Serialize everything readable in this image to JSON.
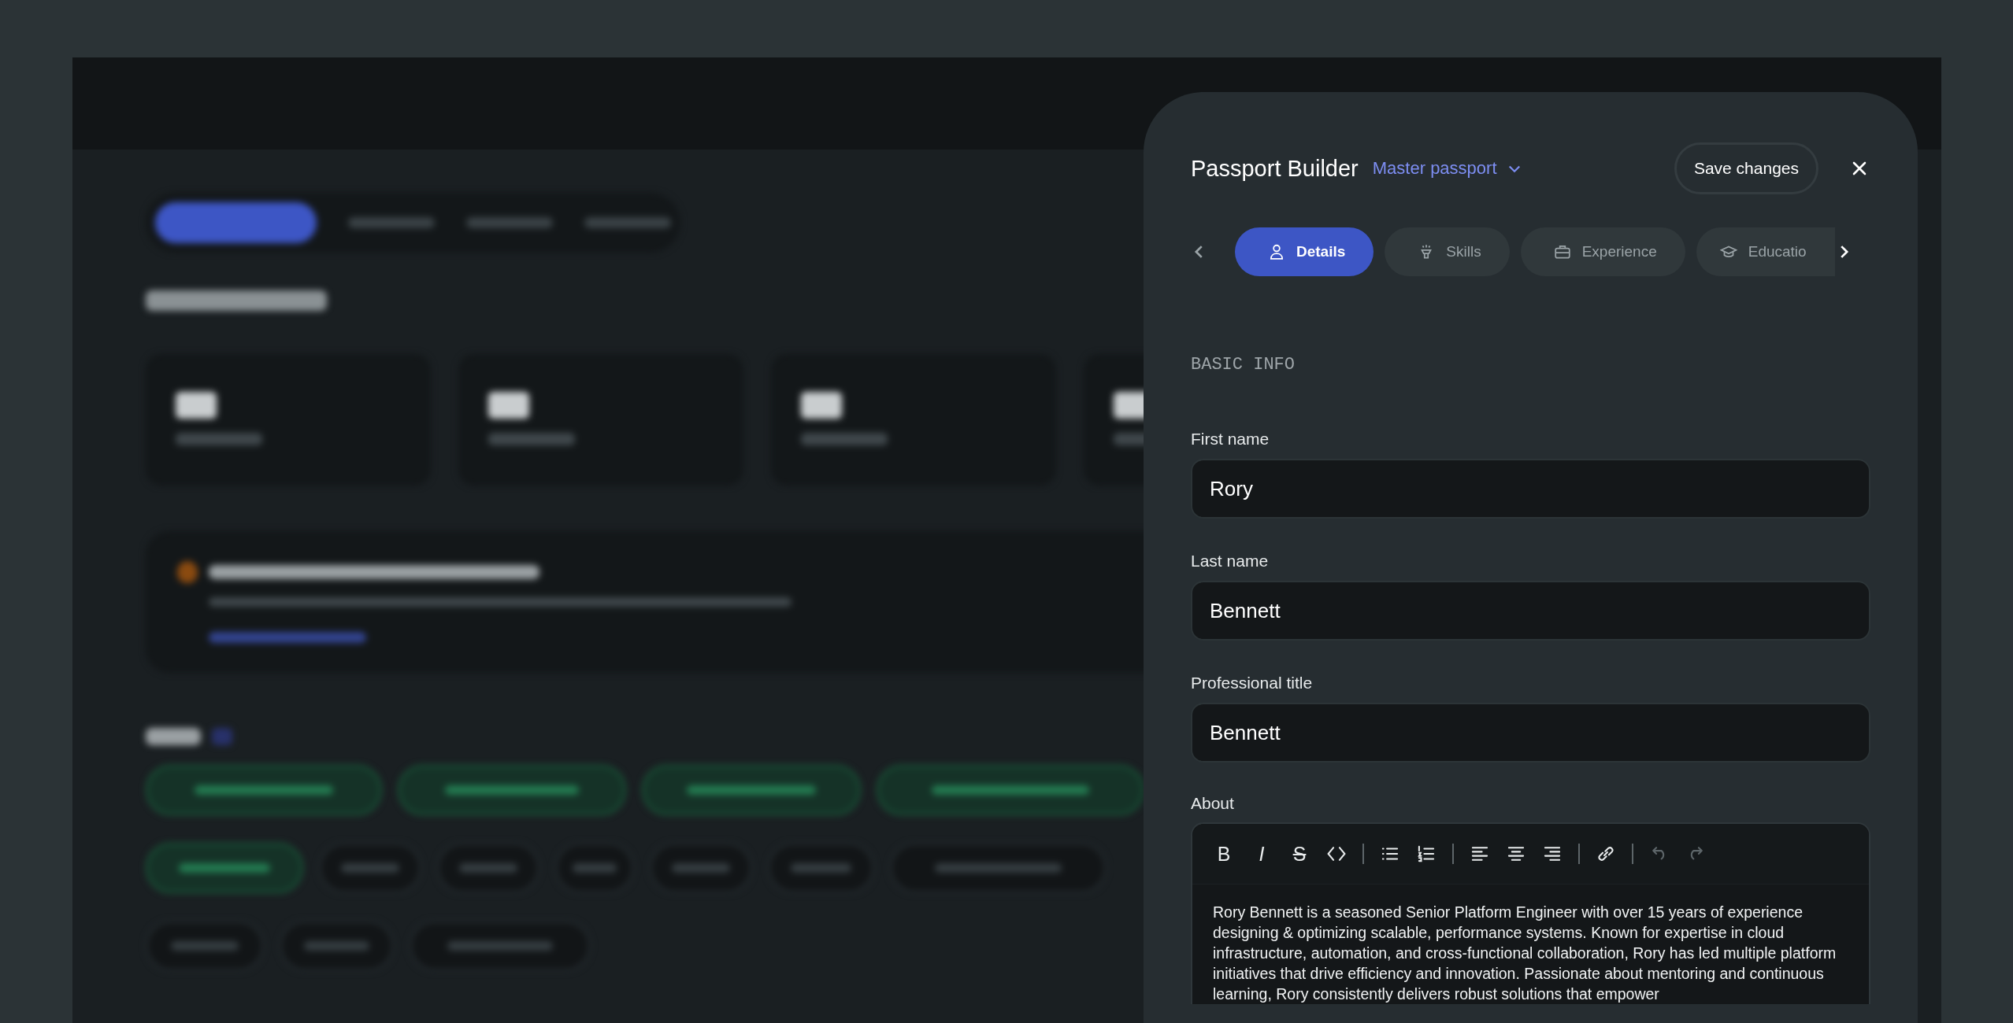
{
  "panel": {
    "title": "Passport Builder",
    "passport_select": "Master passport",
    "save_button": "Save changes",
    "tabs": [
      {
        "label": "Details",
        "selected": true
      },
      {
        "label": "Skills",
        "selected": false
      },
      {
        "label": "Experience",
        "selected": false
      },
      {
        "label": "Educatio",
        "selected": false
      }
    ],
    "section_title": "BASIC INFO",
    "fields": [
      {
        "label": "First name",
        "value": "Rory"
      },
      {
        "label": "Last name",
        "value": "Bennett"
      },
      {
        "label": "Professional title",
        "value": "Bennett"
      }
    ],
    "about_label": "About",
    "toolbar": [
      {
        "kind": "bold",
        "text": "B",
        "disabled": false
      },
      {
        "kind": "italic",
        "text": "I",
        "disabled": false
      },
      {
        "kind": "strike",
        "text": "S",
        "disabled": false
      },
      {
        "kind": "code",
        "disabled": false
      },
      {
        "kind": "sep"
      },
      {
        "kind": "bullets",
        "disabled": false
      },
      {
        "kind": "numbers",
        "disabled": false
      },
      {
        "kind": "sep"
      },
      {
        "kind": "left",
        "disabled": false
      },
      {
        "kind": "center",
        "disabled": false
      },
      {
        "kind": "right",
        "disabled": false
      },
      {
        "kind": "sep"
      },
      {
        "kind": "link",
        "disabled": false
      },
      {
        "kind": "sep"
      },
      {
        "kind": "undo",
        "disabled": true
      },
      {
        "kind": "redo",
        "disabled": true
      }
    ],
    "about_text": "Rory Bennett is a seasoned Senior Platform Engineer with over 15 years of experience designing & optimizing scalable, performance systems. Known for expertise in cloud infrastructure, automation, and cross-functional collaboration, Rory has led multiple platform initiatives that drive efficiency and innovation. Passionate about mentoring and continuous learning, Rory consistently delivers robust solutions that empower"
  }
}
